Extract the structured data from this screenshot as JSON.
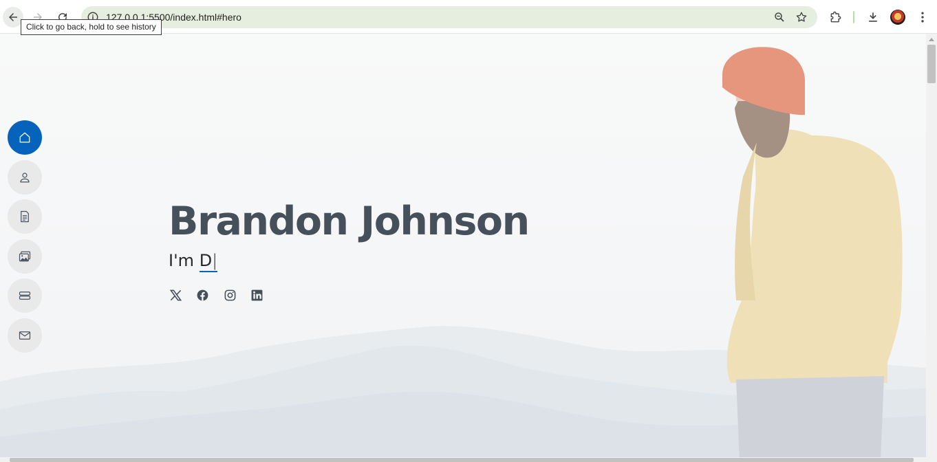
{
  "browser": {
    "url": "127.0.0.1:5500/index.html#hero",
    "tooltip": "Click to go back, hold to see history"
  },
  "sidenav": {
    "items": [
      {
        "name": "home",
        "icon": "house-icon",
        "active": true
      },
      {
        "name": "about",
        "icon": "person-icon",
        "active": false
      },
      {
        "name": "resume",
        "icon": "file-text-icon",
        "active": false
      },
      {
        "name": "portfolio",
        "icon": "images-icon",
        "active": false
      },
      {
        "name": "services",
        "icon": "server-icon",
        "active": false
      },
      {
        "name": "contact",
        "icon": "envelope-icon",
        "active": false
      }
    ]
  },
  "hero": {
    "name": "Brandon Johnson",
    "subtitle_prefix": "I'm ",
    "typed_text": "D",
    "cursor": "|",
    "socials": [
      "twitter-x-icon",
      "facebook-icon",
      "instagram-icon",
      "linkedin-icon"
    ]
  },
  "colors": {
    "accent": "#0563bb",
    "heading": "#45505b",
    "nav_inactive_bg": "#e9e9e9",
    "omnibox_bg": "#e6eedf"
  }
}
